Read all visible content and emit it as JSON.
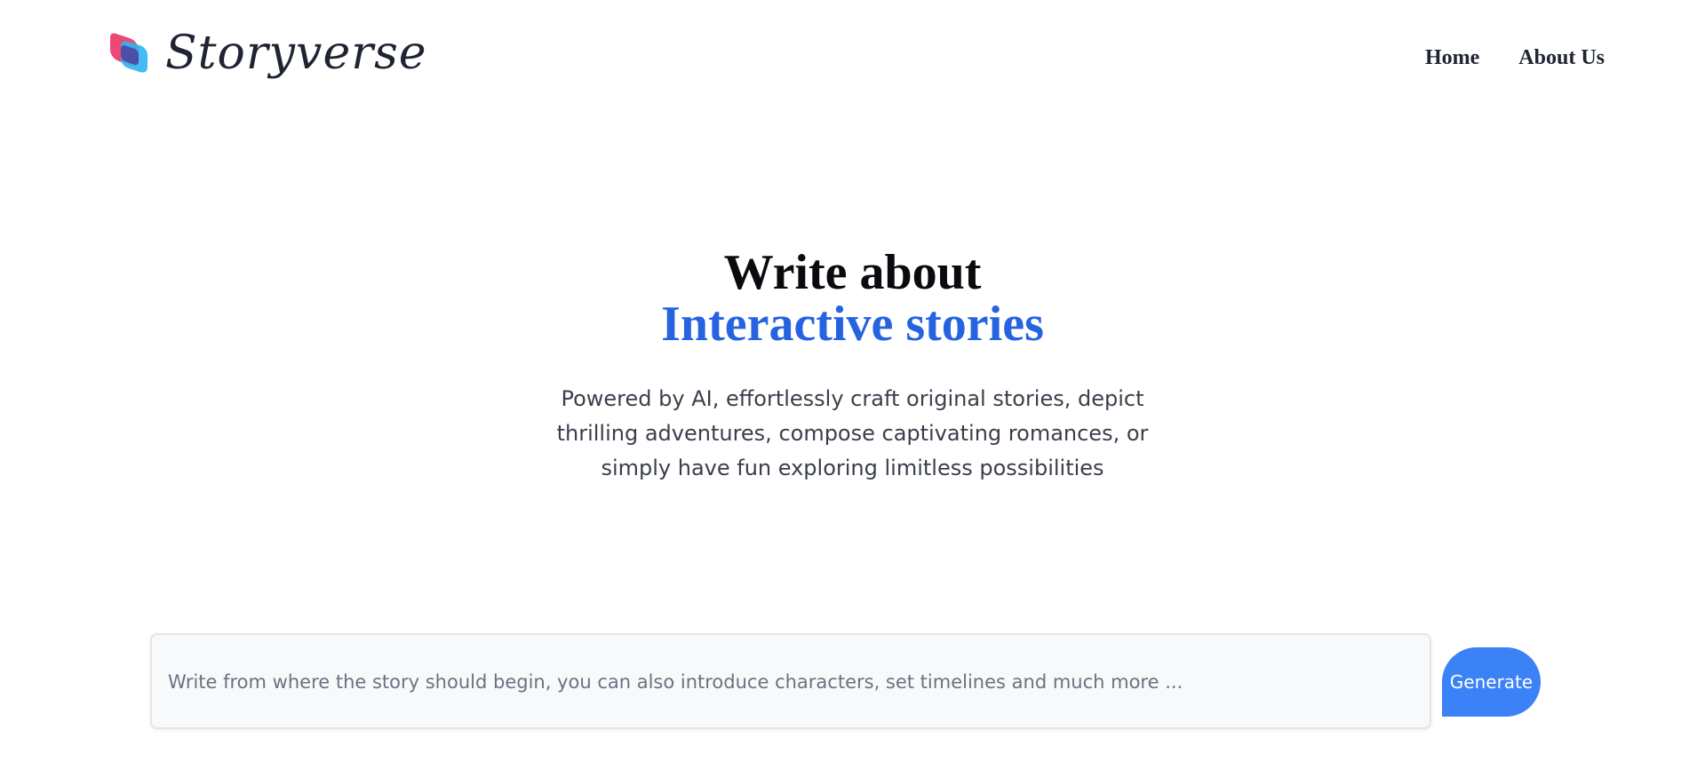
{
  "header": {
    "logo_text": "Storyverse",
    "nav": [
      {
        "label": "Home"
      },
      {
        "label": "About Us"
      }
    ]
  },
  "hero": {
    "title_line1": "Write about",
    "title_line2": "Interactive stories",
    "description": "Powered by AI, effortlessly craft original stories, depict thrilling adventures, compose captivating romances, or simply have fun exploring limitless possibilities"
  },
  "prompt": {
    "placeholder": "Write from where the story should begin, you can also introduce characters, set timelines and much more ...",
    "value": "",
    "button_label": "Generate"
  },
  "colors": {
    "accent": "#2563e0",
    "button": "#3b82f6",
    "logo_pink": "#ec4a72",
    "logo_blue": "#2fb4f2"
  }
}
